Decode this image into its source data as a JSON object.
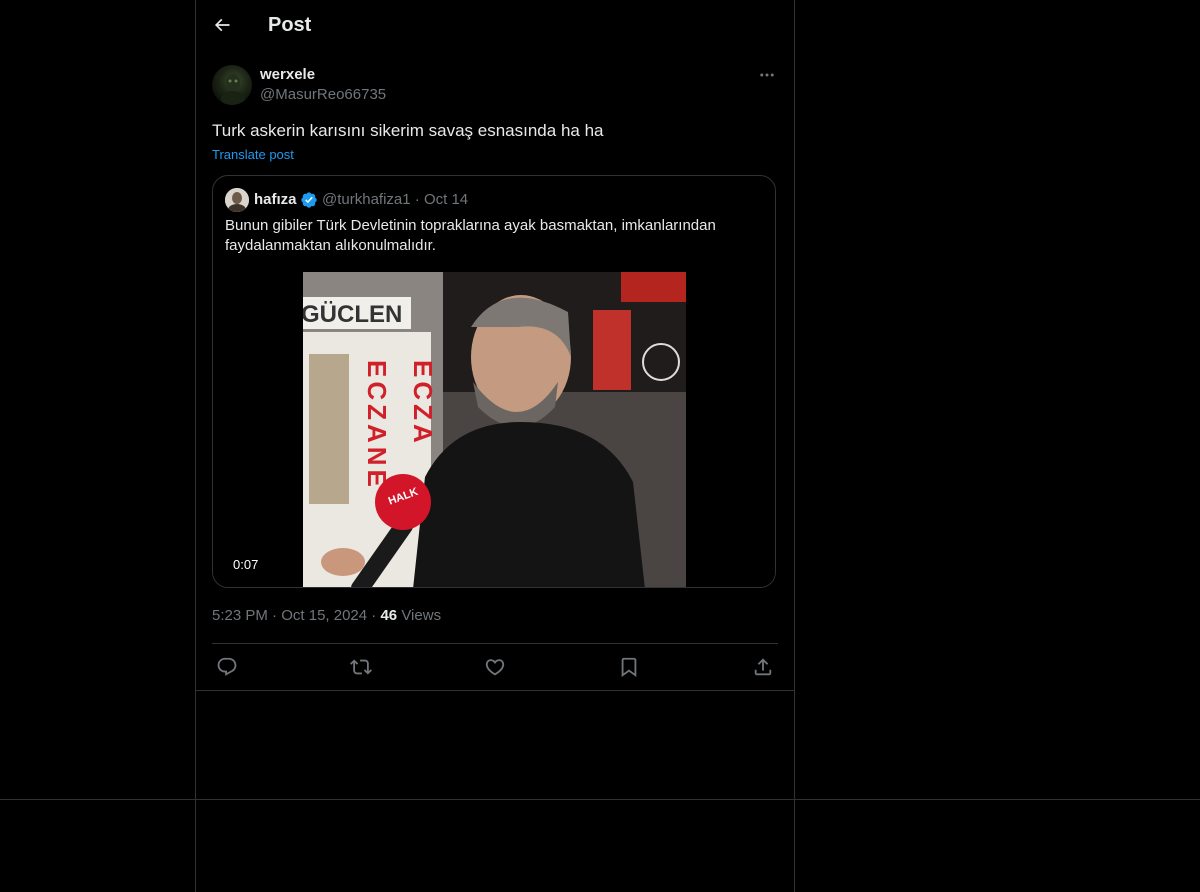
{
  "header": {
    "title": "Post"
  },
  "post": {
    "author_name": "werxele",
    "author_handle": "@MasurReo66735",
    "text": "Turk askerin karısını sikerim savaş esnasında ha ha",
    "translate_label": "Translate post",
    "time": "5:23 PM",
    "date": "Oct 15, 2024",
    "views_count": "46",
    "views_label": "Views"
  },
  "quote": {
    "author_name": "hafıza",
    "author_handle": "@turkhafiza1",
    "date": "Oct 14",
    "text": "Bunun gibiler Türk Devletinin topraklarına ayak basmaktan, imkanlarından faydalanmaktan alıkonulmalıdır.",
    "video_duration": "0:07",
    "video_sign_top": "GÜCLEN",
    "video_sign_left": "ECZANE",
    "video_sign_right": "ECZA",
    "video_mic_label": "HALK"
  },
  "icons": {
    "back": "arrow-left-icon",
    "more": "more-dots-icon",
    "verified": "verified-badge-icon",
    "reply": "reply-icon",
    "repost": "repost-icon",
    "like": "heart-icon",
    "bookmark": "bookmark-icon",
    "share": "share-icon"
  },
  "colors": {
    "background": "#000000",
    "link": "#1d9bf0",
    "verified": "#1d9bf0",
    "muted": "#71767b",
    "border": "#2f3336"
  }
}
